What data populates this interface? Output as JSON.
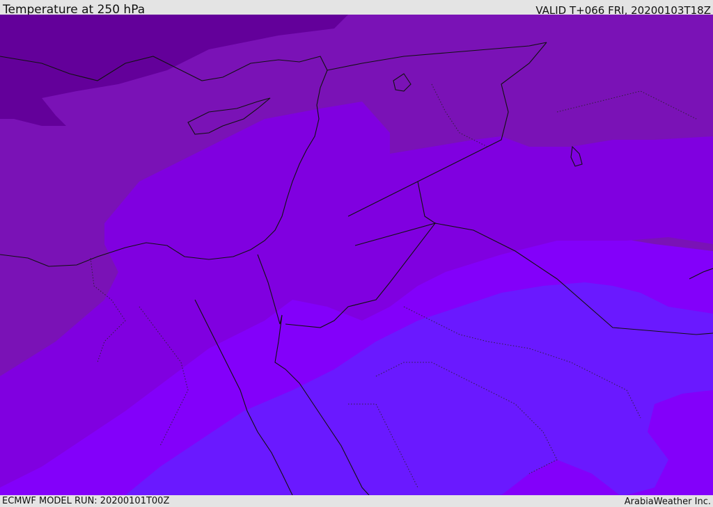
{
  "header": {
    "title": "Temperature at 250 hPa",
    "valid": "VALID T+066 FRI, 20200103T18Z"
  },
  "footer": {
    "model_run": "ECMWF MODEL RUN: 20200101T00Z",
    "credit": "ArabiaWeather Inc."
  },
  "map": {
    "variable": "Temperature",
    "level": "250 hPa",
    "colors": {
      "coldest": "#620095",
      "cold": "#7a10b4",
      "mid": "#8000e0",
      "warm": "#8400fe",
      "warmest": "#6a18ff"
    }
  }
}
